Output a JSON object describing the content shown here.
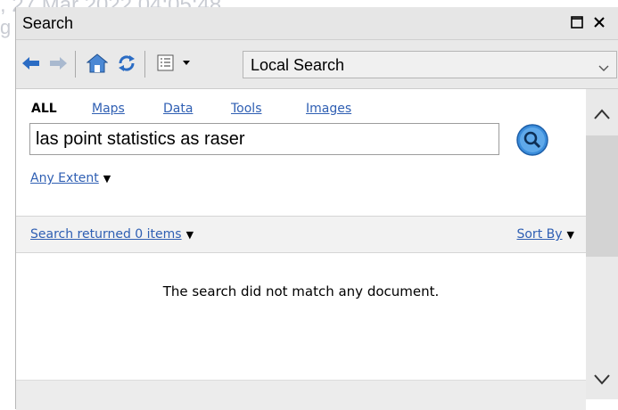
{
  "background": {
    "timestamp_text": ", 27 Mar 2022 04:05:48",
    "edge_text": "g"
  },
  "window": {
    "title": "Search",
    "restore_icon": "square-restore-icon",
    "close_icon": "close-icon"
  },
  "toolbar": {
    "back_icon": "arrow-left-icon",
    "forward_icon": "arrow-right-icon",
    "home_icon": "home-icon",
    "refresh_icon": "refresh-icon",
    "options_icon": "list-options-icon",
    "scope": {
      "selected": "Local Search"
    }
  },
  "search": {
    "categories": {
      "all": "ALL",
      "maps": "Maps",
      "data": "Data",
      "tools": "Tools",
      "images": "Images"
    },
    "query": "las point statistics as raser",
    "extent_label": "Any Extent"
  },
  "results": {
    "count_label": "Search returned 0 items",
    "sort_label": "Sort By",
    "empty_message": "The search did not match any document."
  },
  "colors": {
    "link": "#2f5fb3",
    "toolbar_bg": "#e9e9e9",
    "search_button": "#1e6fbf"
  }
}
